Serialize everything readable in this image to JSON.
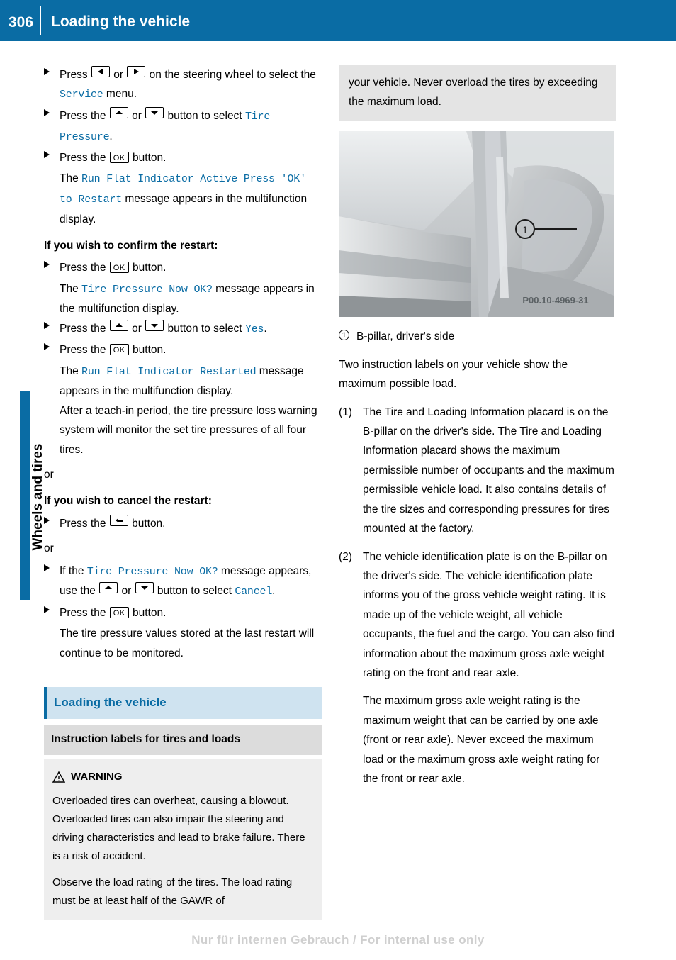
{
  "header": {
    "page_number": "306",
    "title": "Loading the vehicle"
  },
  "side_tab": {
    "label": "Wheels and tires"
  },
  "footer": {
    "text": "Nur für internen Gebrauch / For internal use only"
  },
  "colors": {
    "accent": "#0a6ca4",
    "heading_band": "#cfe3f0",
    "sub_heading_band": "#dcdcdc",
    "note_band": "#e4e4e4",
    "warn_band": "#eeeeee"
  },
  "keys": {
    "left": "left-arrow",
    "right": "right-arrow",
    "up": "up-arrow",
    "down": "down-arrow",
    "ok": "OK",
    "back": "back-arrow"
  },
  "left_column": {
    "steps": [
      {
        "id": "step-select-service",
        "parts": [
          {
            "t": "text",
            "v": "Press "
          },
          {
            "t": "key",
            "v": "left"
          },
          {
            "t": "text",
            "v": " or "
          },
          {
            "t": "key",
            "v": "right"
          },
          {
            "t": "text",
            "v": " on the steering wheel to select the "
          },
          {
            "t": "mono",
            "v": "Service"
          },
          {
            "t": "text",
            "v": " menu."
          }
        ]
      },
      {
        "id": "step-select-tire-pressure",
        "parts": [
          {
            "t": "text",
            "v": "Press the "
          },
          {
            "t": "key",
            "v": "up"
          },
          {
            "t": "text",
            "v": " or "
          },
          {
            "t": "key",
            "v": "down"
          },
          {
            "t": "text",
            "v": " button to select "
          },
          {
            "t": "mono",
            "v": "Tire Pressure"
          },
          {
            "t": "text",
            "v": "."
          }
        ]
      },
      {
        "id": "step-press-ok-1",
        "parts": [
          {
            "t": "text",
            "v": "Press the "
          },
          {
            "t": "key",
            "v": "ok"
          },
          {
            "t": "text",
            "v": " button."
          }
        ],
        "continuation": [
          {
            "t": "text",
            "v": "The "
          },
          {
            "t": "mono",
            "v": "Run Flat Indicator Active Press 'OK' to Restart"
          },
          {
            "t": "text",
            "v": " message appears in the multifunction display."
          }
        ]
      }
    ],
    "confirm_heading": "If you wish to confirm the restart:",
    "confirm_steps": [
      {
        "id": "step-press-ok-2",
        "parts": [
          {
            "t": "text",
            "v": "Press the "
          },
          {
            "t": "key",
            "v": "ok"
          },
          {
            "t": "text",
            "v": " button."
          }
        ],
        "continuation": [
          {
            "t": "text",
            "v": "The "
          },
          {
            "t": "mono",
            "v": "Tire Pressure Now OK?"
          },
          {
            "t": "text",
            "v": " message appears in the multifunction display."
          }
        ]
      },
      {
        "id": "step-select-yes",
        "parts": [
          {
            "t": "text",
            "v": "Press the "
          },
          {
            "t": "key",
            "v": "up"
          },
          {
            "t": "text",
            "v": " or "
          },
          {
            "t": "key",
            "v": "down"
          },
          {
            "t": "text",
            "v": " button to select "
          },
          {
            "t": "mono",
            "v": "Yes"
          },
          {
            "t": "text",
            "v": "."
          }
        ]
      },
      {
        "id": "step-press-ok-3",
        "parts": [
          {
            "t": "text",
            "v": "Press the "
          },
          {
            "t": "key",
            "v": "ok"
          },
          {
            "t": "text",
            "v": " button."
          }
        ],
        "continuation": [
          {
            "t": "text",
            "v": "The "
          },
          {
            "t": "mono",
            "v": "Run Flat Indicator Restarted"
          },
          {
            "t": "text",
            "v": " message appears in the multifunction display."
          }
        ],
        "continuation2": "After a teach-in period, the tire pressure loss warning system will monitor the set tire pressures of all four tires."
      }
    ],
    "or_1": "or",
    "cancel_heading": "If you wish to cancel the restart:",
    "cancel_steps": [
      {
        "id": "step-press-back",
        "parts": [
          {
            "t": "text",
            "v": "Press the "
          },
          {
            "t": "key",
            "v": "back"
          },
          {
            "t": "text",
            "v": " button."
          }
        ]
      }
    ],
    "or_2": "or",
    "cancel_steps_2": [
      {
        "id": "step-select-cancel",
        "parts": [
          {
            "t": "text",
            "v": "If the "
          },
          {
            "t": "mono",
            "v": "Tire Pressure Now OK?"
          },
          {
            "t": "text",
            "v": " message appears, use the "
          },
          {
            "t": "key",
            "v": "up"
          },
          {
            "t": "text",
            "v": " or "
          },
          {
            "t": "key",
            "v": "down"
          },
          {
            "t": "text",
            "v": " button to select "
          },
          {
            "t": "mono",
            "v": "Cancel"
          },
          {
            "t": "text",
            "v": "."
          }
        ]
      },
      {
        "id": "step-press-ok-4",
        "parts": [
          {
            "t": "text",
            "v": "Press the "
          },
          {
            "t": "key",
            "v": "ok"
          },
          {
            "t": "text",
            "v": " button."
          }
        ],
        "continuation": [
          {
            "t": "text",
            "v": "The tire pressure values stored at the last restart will continue to be monitored."
          }
        ]
      }
    ],
    "section_heading": "Loading the vehicle",
    "sub_section_heading": "Instruction labels for tires and loads",
    "warning": {
      "title": "WARNING",
      "paragraphs": [
        "Overloaded tires can overheat, causing a blowout. Overloaded tires can also impair the steering and driving characteristics and lead to brake failure. There is a risk of accident.",
        "Observe the load rating of the tires. The load rating must be at least half of the GAWR of"
      ]
    }
  },
  "right_column": {
    "note_continued": "your vehicle. Never overload the tires by exceeding the maximum load.",
    "figure": {
      "name": "b-pillar-photo",
      "watermark": "P00.10-4969-31",
      "callout": "1"
    },
    "figure_caption": {
      "num": "1",
      "text": "B-pillar, driver's side"
    },
    "intro": "Two instruction labels on your vehicle show the maximum possible load.",
    "items": [
      {
        "num": "(1)",
        "text": "The Tire and Loading Information placard is on the B-pillar on the driver's side. The Tire and Loading Information placard shows the maximum permissible number of occupants and the maximum permissible vehicle load. It also contains details of the tire sizes and corresponding pressures for tires mounted at the factory."
      },
      {
        "num": "(2)",
        "text": "The vehicle identification plate is on the B-pillar on the driver's side. The vehicle identification plate informs you of the gross vehicle weight rating. It is made up of the vehicle weight, all vehicle occupants, the fuel and the cargo. You can also find information about the maximum gross axle weight rating on the front and rear axle."
      }
    ],
    "item_sub": "The maximum gross axle weight rating is the maximum weight that can be carried by one axle (front or rear axle). Never exceed the maximum load or the maximum gross axle weight rating for the front or rear axle."
  }
}
